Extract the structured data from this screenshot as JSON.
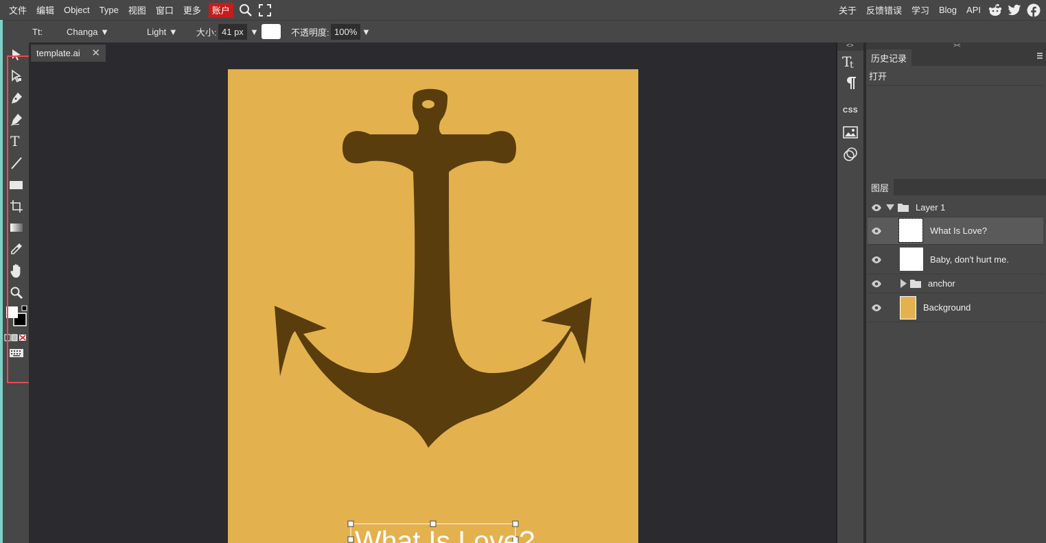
{
  "menu": {
    "left": [
      "文件",
      "编辑",
      "Object",
      "Type",
      "视图",
      "窗口",
      "更多"
    ],
    "account": "账户",
    "right": [
      "关于",
      "反馈错误",
      "学习",
      "Blog",
      "API"
    ]
  },
  "options": {
    "tool_label": "Tt:",
    "font_family": "Changa",
    "font_weight": "Light",
    "size_label": "大小:",
    "size_value": "41 px",
    "opacity_label": "不透明度:",
    "opacity_value": "100%",
    "dropdown_arrow": "▼"
  },
  "document": {
    "tab_title": "template.ai",
    "close": "✕",
    "background_color": "#e3b24e",
    "anchor_color": "#5a3d0c",
    "text_preview": "What Is Love?"
  },
  "right_icons": {
    "css_label": "CSS",
    "collapse_left": "<>",
    "collapse_right": "><"
  },
  "history": {
    "title": "历史记录",
    "items": [
      "打开"
    ]
  },
  "layers": {
    "title": "图层",
    "items": [
      {
        "name": "Layer 1",
        "type": "folder",
        "expanded": true
      },
      {
        "name": "What Is Love?",
        "type": "text",
        "selected": true
      },
      {
        "name": "Baby, don't hurt me.",
        "type": "text"
      },
      {
        "name": "anchor",
        "type": "folder",
        "expanded": false
      },
      {
        "name": "Background",
        "type": "image"
      }
    ]
  },
  "colors": {
    "panel": "#474747",
    "menu_account": "#c41d1d",
    "highlight": "#e84b50",
    "accent": "#7ed0c8"
  }
}
